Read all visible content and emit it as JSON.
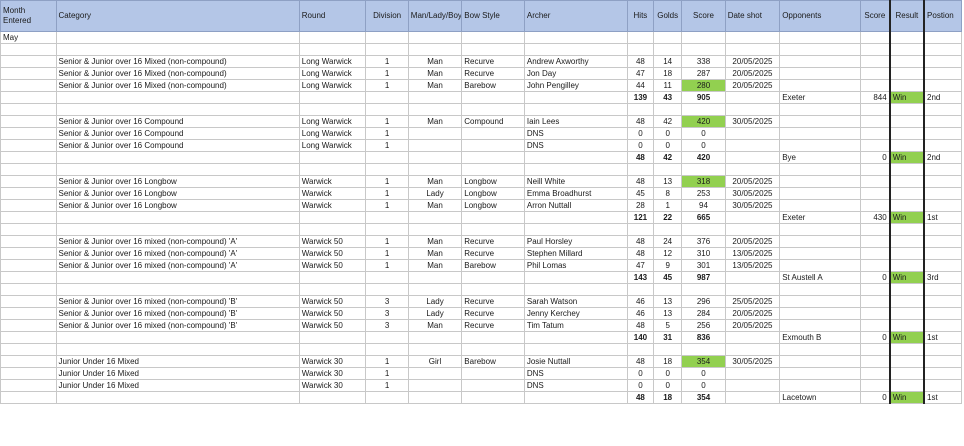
{
  "headers": {
    "month": "Month Entered",
    "category": "Category",
    "round": "Round",
    "division": "Division",
    "gender": "Man/Lady/Boy/Girl",
    "bow": "Bow Style",
    "archer": "Archer",
    "hits": "Hits",
    "golds": "Golds",
    "score": "Score",
    "date": "Date shot",
    "opponents": "Opponents",
    "opp_score": "Score",
    "result": "Result",
    "position": "Postion"
  },
  "month_label": "May",
  "highlight_color": "#92d050",
  "header_color": "#b4c6e7",
  "rows": [
    {
      "type": "blank"
    },
    {
      "type": "entry",
      "category": "Senior & Junior over 16 Mixed (non-compound)",
      "round": "Long Warwick",
      "division": "1",
      "gender": "Man",
      "bow": "Recurve",
      "archer": "Andrew Axworthy",
      "hits": "48",
      "golds": "14",
      "score": "338",
      "hl": false,
      "date": "20/05/2025"
    },
    {
      "type": "entry",
      "category": "Senior & Junior over 16 Mixed (non-compound)",
      "round": "Long Warwick",
      "division": "1",
      "gender": "Man",
      "bow": "Recurve",
      "archer": "Jon Day",
      "hits": "47",
      "golds": "18",
      "score": "287",
      "hl": false,
      "date": "20/05/2025"
    },
    {
      "type": "entry",
      "category": "Senior & Junior over 16 Mixed (non-compound)",
      "round": "Long Warwick",
      "division": "1",
      "gender": "Man",
      "bow": "Barebow",
      "archer": "John Pengilley",
      "hits": "44",
      "golds": "11",
      "score": "280",
      "hl": true,
      "date": "20/05/2025"
    },
    {
      "type": "total",
      "hits": "139",
      "golds": "43",
      "score": "905",
      "opponent": "Exeter",
      "opp_score": "844",
      "result": "Win",
      "position": "2nd"
    },
    {
      "type": "blank"
    },
    {
      "type": "entry",
      "category": "Senior & Junior over 16 Compound",
      "round": "Long Warwick",
      "division": "1",
      "gender": "Man",
      "bow": "Compound",
      "archer": "Iain Lees",
      "hits": "48",
      "golds": "42",
      "score": "420",
      "hl": true,
      "date": "30/05/2025"
    },
    {
      "type": "entry",
      "category": "Senior & Junior over 16 Compound",
      "round": "Long Warwick",
      "division": "1",
      "gender": "",
      "bow": "",
      "archer": "DNS",
      "hits": "0",
      "golds": "0",
      "score": "0",
      "hl": false,
      "date": ""
    },
    {
      "type": "entry",
      "category": "Senior & Junior over 16 Compound",
      "round": "Long Warwick",
      "division": "1",
      "gender": "",
      "bow": "",
      "archer": "DNS",
      "hits": "0",
      "golds": "0",
      "score": "0",
      "hl": false,
      "date": ""
    },
    {
      "type": "total",
      "hits": "48",
      "golds": "42",
      "score": "420",
      "opponent": "Bye",
      "opp_score": "0",
      "result": "Win",
      "position": "2nd"
    },
    {
      "type": "blank"
    },
    {
      "type": "entry",
      "category": "Senior & Junior over 16 Longbow",
      "round": "Warwick",
      "division": "1",
      "gender": "Man",
      "bow": "Longbow",
      "archer": "Neill White",
      "hits": "48",
      "golds": "13",
      "score": "318",
      "hl": true,
      "date": "20/05/2025"
    },
    {
      "type": "entry",
      "category": "Senior & Junior over 16 Longbow",
      "round": "Warwick",
      "division": "1",
      "gender": "Lady",
      "bow": "Longbow",
      "archer": "Emma Broadhurst",
      "hits": "45",
      "golds": "8",
      "score": "253",
      "hl": false,
      "date": "30/05/2025"
    },
    {
      "type": "entry",
      "category": "Senior & Junior over 16 Longbow",
      "round": "Warwick",
      "division": "1",
      "gender": "Man",
      "bow": "Longbow",
      "archer": "Arron Nuttall",
      "hits": "28",
      "golds": "1",
      "score": "94",
      "hl": false,
      "date": "30/05/2025"
    },
    {
      "type": "total",
      "hits": "121",
      "golds": "22",
      "score": "665",
      "opponent": "Exeter",
      "opp_score": "430",
      "result": "Win",
      "position": "1st"
    },
    {
      "type": "blank"
    },
    {
      "type": "entry",
      "category": "Senior & Junior over 16 mixed (non-compound) 'A'",
      "round": "Warwick 50",
      "division": "1",
      "gender": "Man",
      "bow": "Recurve",
      "archer": "Paul Horsley",
      "hits": "48",
      "golds": "24",
      "score": "376",
      "hl": false,
      "date": "20/05/2025"
    },
    {
      "type": "entry",
      "category": "Senior & Junior over 16 mixed (non-compound) 'A'",
      "round": "Warwick 50",
      "division": "1",
      "gender": "Man",
      "bow": "Recurve",
      "archer": "Stephen Millard",
      "hits": "48",
      "golds": "12",
      "score": "310",
      "hl": false,
      "date": "13/05/2025"
    },
    {
      "type": "entry",
      "category": "Senior & Junior over 16 mixed (non-compound) 'A'",
      "round": "Warwick 50",
      "division": "1",
      "gender": "Man",
      "bow": "Barebow",
      "archer": "Phil Lomas",
      "hits": "47",
      "golds": "9",
      "score": "301",
      "hl": false,
      "date": "13/05/2025"
    },
    {
      "type": "total",
      "hits": "143",
      "golds": "45",
      "score": "987",
      "opponent": "St Austell A",
      "opp_score": "0",
      "result": "Win",
      "position": "3rd"
    },
    {
      "type": "blank"
    },
    {
      "type": "entry",
      "category": "Senior & Junior over 16 mixed (non-compound) 'B'",
      "round": "Warwick 50",
      "division": "3",
      "gender": "Lady",
      "bow": "Recurve",
      "archer": "Sarah Watson",
      "hits": "46",
      "golds": "13",
      "score": "296",
      "hl": false,
      "date": "25/05/2025"
    },
    {
      "type": "entry",
      "category": "Senior & Junior over 16 mixed (non-compound) 'B'",
      "round": "Warwick 50",
      "division": "3",
      "gender": "Lady",
      "bow": "Recurve",
      "archer": "Jenny Kerchey",
      "hits": "46",
      "golds": "13",
      "score": "284",
      "hl": false,
      "date": "20/05/2025"
    },
    {
      "type": "entry",
      "category": "Senior & Junior over 16 mixed (non-compound) 'B'",
      "round": "Warwick 50",
      "division": "3",
      "gender": "Man",
      "bow": "Recurve",
      "archer": "Tim Tatum",
      "hits": "48",
      "golds": "5",
      "score": "256",
      "hl": false,
      "date": "20/05/2025"
    },
    {
      "type": "total",
      "hits": "140",
      "golds": "31",
      "score": "836",
      "opponent": "Exmouth B",
      "opp_score": "0",
      "result": "Win",
      "position": "1st"
    },
    {
      "type": "blank"
    },
    {
      "type": "entry",
      "category": "Junior Under 16 Mixed",
      "round": "Warwick 30",
      "division": "1",
      "gender": "Girl",
      "bow": "Barebow",
      "archer": "Josie Nuttall",
      "hits": "48",
      "golds": "18",
      "score": "354",
      "hl": true,
      "date": "30/05/2025"
    },
    {
      "type": "entry",
      "category": "Junior Under 16 Mixed",
      "round": "Warwick 30",
      "division": "1",
      "gender": "",
      "bow": "",
      "archer": "DNS",
      "hits": "0",
      "golds": "0",
      "score": "0",
      "hl": false,
      "date": ""
    },
    {
      "type": "entry",
      "category": "Junior Under 16 Mixed",
      "round": "Warwick 30",
      "division": "1",
      "gender": "",
      "bow": "",
      "archer": "DNS",
      "hits": "0",
      "golds": "0",
      "score": "0",
      "hl": false,
      "date": ""
    },
    {
      "type": "total",
      "hits": "48",
      "golds": "18",
      "score": "354",
      "opponent": "Lacetown",
      "opp_score": "0",
      "result": "Win",
      "position": "1st"
    }
  ]
}
